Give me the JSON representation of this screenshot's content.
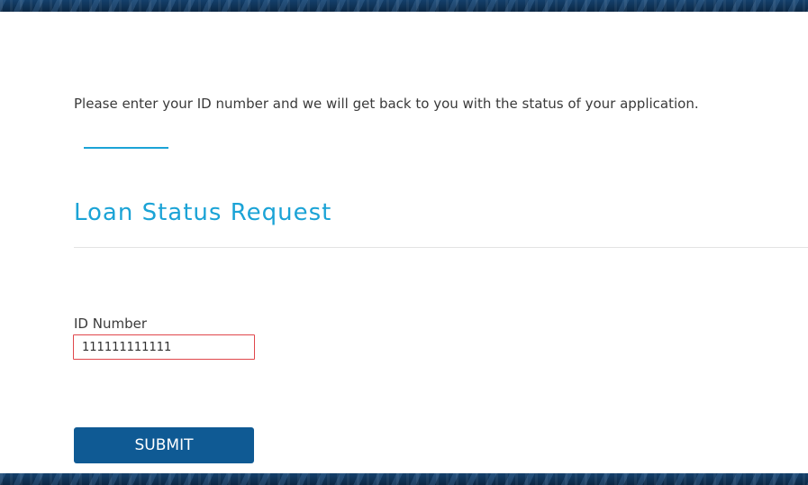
{
  "intro": {
    "text": "Please enter your ID number and we will get back to you with the status of your application."
  },
  "form": {
    "title": "Loan Status Request",
    "id_field": {
      "label": "ID Number",
      "value": "111111111111",
      "state": "error"
    },
    "submit_label": "SUBMIT"
  },
  "colors": {
    "accent": "#1ba3d6",
    "button": "#0f5a94",
    "error_border": "#e0474c",
    "header_band": "#0d2d4f"
  }
}
